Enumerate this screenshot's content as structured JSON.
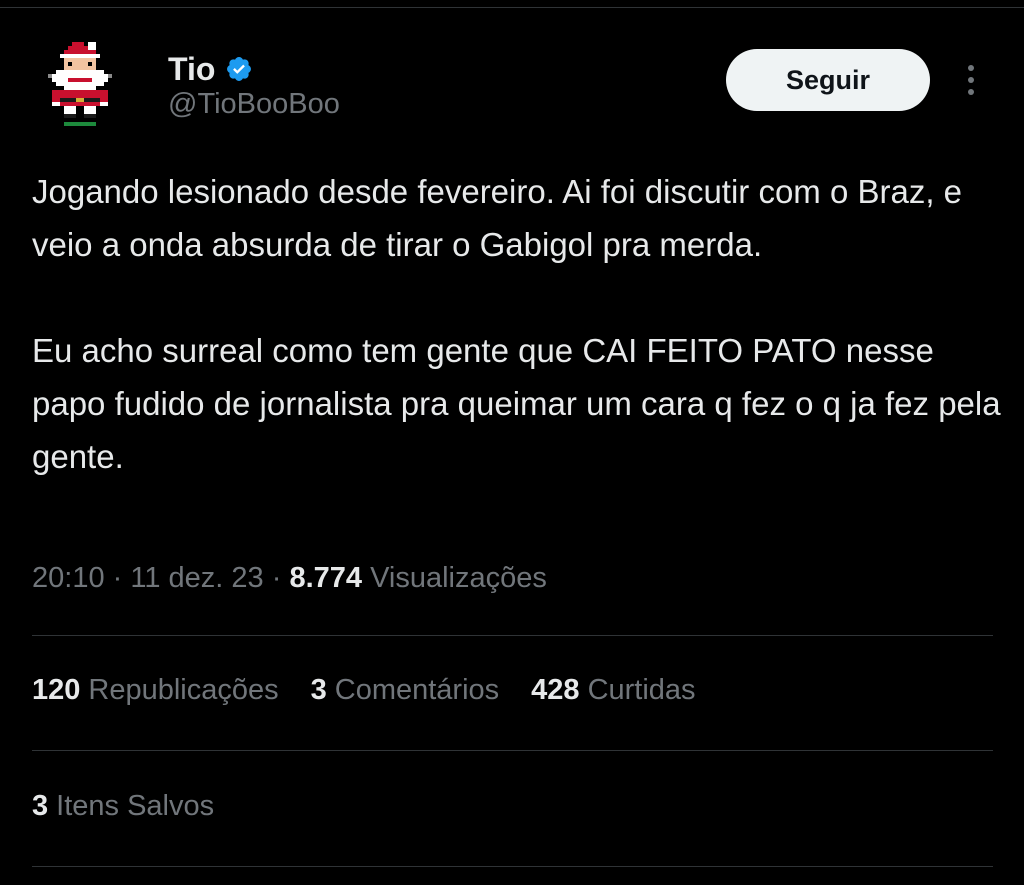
{
  "colors": {
    "background": "#000000",
    "text_primary": "#e7e9ea",
    "text_secondary": "#71767b",
    "divider": "#2f3336",
    "verified_badge": "#1d9bf0",
    "follow_button_bg": "#eff3f4",
    "follow_button_text": "#0f1419"
  },
  "author": {
    "display_name": "Tio",
    "handle": "@TioBooBoo",
    "verified": true,
    "avatar_icon": "pixel-santa-avatar",
    "verified_icon": "verified-badge-icon"
  },
  "actions": {
    "follow_label": "Seguir",
    "more_icon": "more-vertical-icon"
  },
  "tweet": {
    "paragraphs": [
      "Jogando lesionado desde fevereiro. Ai foi discutir com o Braz, e veio a onda absurda de tirar o Gabigol pra merda.",
      "Eu acho surreal como tem gente que CAI FEITO PATO nesse papo fudido de jornalista pra queimar um cara q fez o q ja fez pela gente."
    ]
  },
  "meta": {
    "time": "20:10",
    "separator": " · ",
    "date": "11 dez. 23",
    "views_count": "8.774",
    "views_label": "Visualizações"
  },
  "stats": {
    "reposts": {
      "count": "120",
      "label": "Republicações"
    },
    "quotes": {
      "count": "3",
      "label": "Comentários"
    },
    "likes": {
      "count": "428",
      "label": "Curtidas"
    },
    "bookmarks": {
      "count": "3",
      "label": "Itens Salvos"
    }
  }
}
